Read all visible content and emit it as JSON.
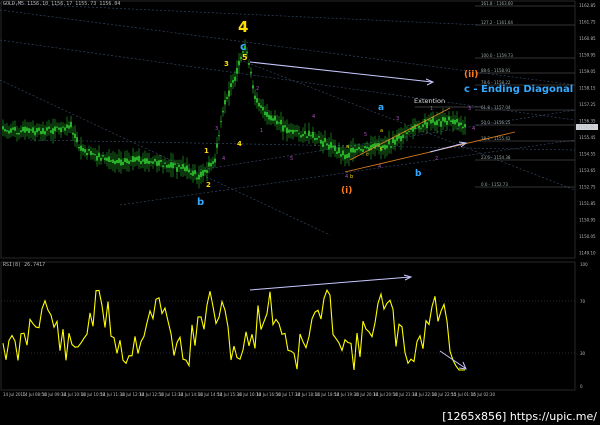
{
  "main_header": "GOLD,M5  1156.10 1156.17 1155.73 1156.04",
  "rsi_header": "RSI(8) 26.7417",
  "watermark": "[1265x856] https://upic.me/",
  "annotations": {
    "wave_4": "4",
    "wave_c_top": "c",
    "wave_5_top": "5",
    "wave_ii": "(ii)",
    "ending_diagonal": "c - Ending Diagonal",
    "extention": "Extention",
    "wave_a_right": "a",
    "wave_b_right": "b",
    "wave_b_left": "b",
    "wave_i": "(i)",
    "num_3": "3",
    "num_4": "4",
    "num_2": "2",
    "num_1": "1"
  },
  "fib_labels": [
    "161.8 - 1163.60",
    "127.2 - 1161.64",
    "100.0 - 1159.73",
    "88.6 - 1158.91",
    "78.6 - 1158.22",
    "61.8 - 1157.04",
    "50.0 - 1156.25",
    "38.2 - 1155.42",
    "23.6 - 1154.38",
    "0.0 - 1152.73"
  ],
  "price_labels": [
    "1162.85",
    "1161.75",
    "1160.85",
    "1159.95",
    "1159.05",
    "1158.15",
    "1157.25",
    "1156.35",
    "1155.45",
    "1154.55",
    "1153.65",
    "1152.75",
    "1151.85",
    "1150.95",
    "1150.05",
    "1149.10"
  ],
  "current_price": "1156.04",
  "rsi_levels": [
    "100",
    "70",
    "30",
    "0"
  ],
  "time_labels": [
    "14 Jul 2015",
    "14 Jul 08:50",
    "14 Jul 09:30",
    "14 Jul 10:10",
    "14 Jul 10:50",
    "14 Jul 11:30",
    "14 Jul 12:10",
    "14 Jul 12:50",
    "14 Jul 13:30",
    "14 Jul 14:10",
    "14 Jul 14:50",
    "14 Jul 15:30",
    "14 Jul 16:10",
    "14 Jul 16:50",
    "14 Jul 17:30",
    "14 Jul 18:10",
    "14 Jul 18:50",
    "14 Jul 19:30",
    "14 Jul 20:10",
    "14 Jul 20:50",
    "14 Jul 21:30",
    "14 Jul 22:10",
    "14 Jul 22:50",
    "15 Jul 01:10",
    "15 Jul 02:30"
  ],
  "colors": {
    "candle": "#33dd33",
    "rsi_line": "#ffff00",
    "wave_yellow": "#ffdd00",
    "wave_blue": "#33aaff",
    "wave_orange": "#ff7a1a",
    "wave_purple": "#b050c0",
    "trendline_main": "#8888cc",
    "trendline_orange": "#e08020",
    "channel_dots": "#3a5070",
    "arrow": "#c8c8ff"
  }
}
